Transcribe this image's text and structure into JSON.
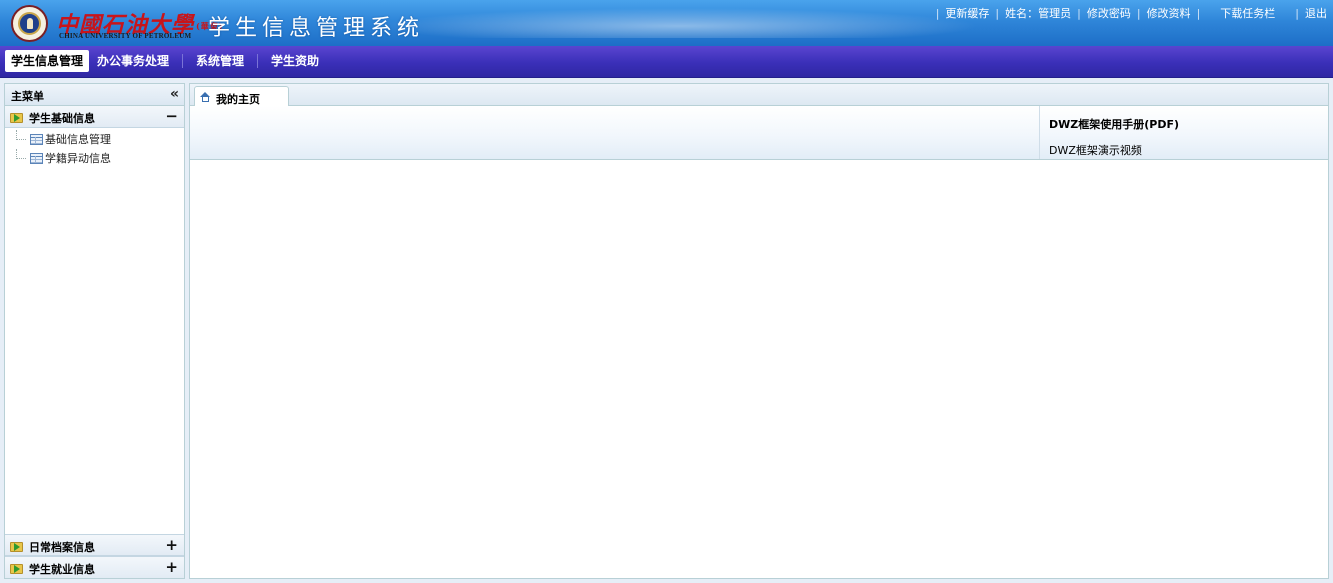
{
  "header": {
    "university_cn": "中國石油大學",
    "university_mark": "(華東)",
    "university_en": "CHINA UNIVERSITY OF PETROLEUM",
    "system_title": "学生信息管理系统",
    "links": {
      "refresh_cache": "更新缓存",
      "user_name": "姓名：管理员",
      "change_password": "修改密码",
      "edit_profile": "修改资料",
      "download_taskbar": "下载任务栏",
      "logout": "退出"
    }
  },
  "nav": {
    "items": [
      "学生信息管理",
      "办公事务处理",
      "系统管理",
      "学生资助"
    ],
    "active_index": 0
  },
  "sidebar": {
    "title": "主菜单",
    "collapse_glyph": "«",
    "groups": [
      {
        "label": "学生基础信息",
        "toggle": "−",
        "expanded": true,
        "items": [
          "基础信息管理",
          "学籍异动信息"
        ]
      },
      {
        "label": "日常档案信息",
        "toggle": "+",
        "expanded": false
      },
      {
        "label": "学生就业信息",
        "toggle": "+",
        "expanded": false
      }
    ]
  },
  "main": {
    "tab_label": "我的主页",
    "banner_links": {
      "manual": "DWZ框架使用手册(PDF)",
      "video": "DWZ框架演示视频"
    }
  },
  "colors": {
    "header_blue": "#2f86d9",
    "nav_purple": "#3a2fb8",
    "logo_red": "#c8141a",
    "border": "#b8d0d6"
  }
}
